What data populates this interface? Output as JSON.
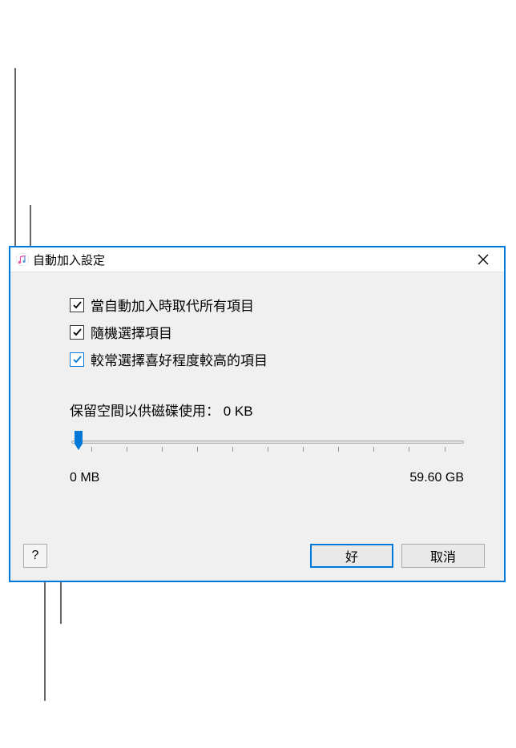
{
  "dialog": {
    "title": "自動加入設定",
    "checkboxes": [
      {
        "label": "當自動加入時取代所有項目",
        "checked": true,
        "style": "black"
      },
      {
        "label": "隨機選擇項目",
        "checked": true,
        "style": "black"
      },
      {
        "label": "較常選擇喜好程度較高的項目",
        "checked": true,
        "style": "blue"
      }
    ],
    "reserve": {
      "label_prefix": "保留空間以供磁碟使用：",
      "value": "0 KB",
      "min_label": "0 MB",
      "max_label": "59.60 GB"
    },
    "buttons": {
      "help": "?",
      "ok": "好",
      "cancel": "取消"
    }
  }
}
